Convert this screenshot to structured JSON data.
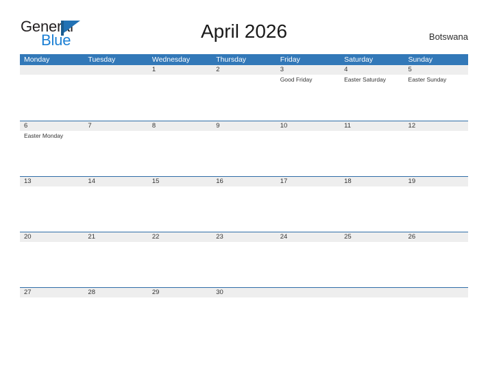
{
  "logo": {
    "word_top": "General",
    "word_bottom": "Blue",
    "flag_icon": "blue-flag-triangle-icon",
    "color_top": "#231f20",
    "color_bottom": "#1b7fd4",
    "accent": "#2272b4"
  },
  "header": {
    "title": "April 2026",
    "region": "Botswana"
  },
  "theme": {
    "header_blue": "#3278b8",
    "row_divider_blue": "#2d6ca6",
    "day_band_gray": "#eeeeee",
    "text_dark": "#333333"
  },
  "weekdays": [
    "Monday",
    "Tuesday",
    "Wednesday",
    "Thursday",
    "Friday",
    "Saturday",
    "Sunday"
  ],
  "weeks": [
    {
      "days": [
        {
          "num": "",
          "events": []
        },
        {
          "num": "",
          "events": []
        },
        {
          "num": "1",
          "events": []
        },
        {
          "num": "2",
          "events": []
        },
        {
          "num": "3",
          "events": [
            "Good Friday"
          ]
        },
        {
          "num": "4",
          "events": [
            "Easter Saturday"
          ]
        },
        {
          "num": "5",
          "events": [
            "Easter Sunday"
          ]
        }
      ]
    },
    {
      "days": [
        {
          "num": "6",
          "events": [
            "Easter Monday"
          ]
        },
        {
          "num": "7",
          "events": []
        },
        {
          "num": "8",
          "events": []
        },
        {
          "num": "9",
          "events": []
        },
        {
          "num": "10",
          "events": []
        },
        {
          "num": "11",
          "events": []
        },
        {
          "num": "12",
          "events": []
        }
      ]
    },
    {
      "days": [
        {
          "num": "13",
          "events": []
        },
        {
          "num": "14",
          "events": []
        },
        {
          "num": "15",
          "events": []
        },
        {
          "num": "16",
          "events": []
        },
        {
          "num": "17",
          "events": []
        },
        {
          "num": "18",
          "events": []
        },
        {
          "num": "19",
          "events": []
        }
      ]
    },
    {
      "days": [
        {
          "num": "20",
          "events": []
        },
        {
          "num": "21",
          "events": []
        },
        {
          "num": "22",
          "events": []
        },
        {
          "num": "23",
          "events": []
        },
        {
          "num": "24",
          "events": []
        },
        {
          "num": "25",
          "events": []
        },
        {
          "num": "26",
          "events": []
        }
      ]
    },
    {
      "days": [
        {
          "num": "27",
          "events": []
        },
        {
          "num": "28",
          "events": []
        },
        {
          "num": "29",
          "events": []
        },
        {
          "num": "30",
          "events": []
        },
        {
          "num": "",
          "events": []
        },
        {
          "num": "",
          "events": []
        },
        {
          "num": "",
          "events": []
        }
      ]
    }
  ]
}
